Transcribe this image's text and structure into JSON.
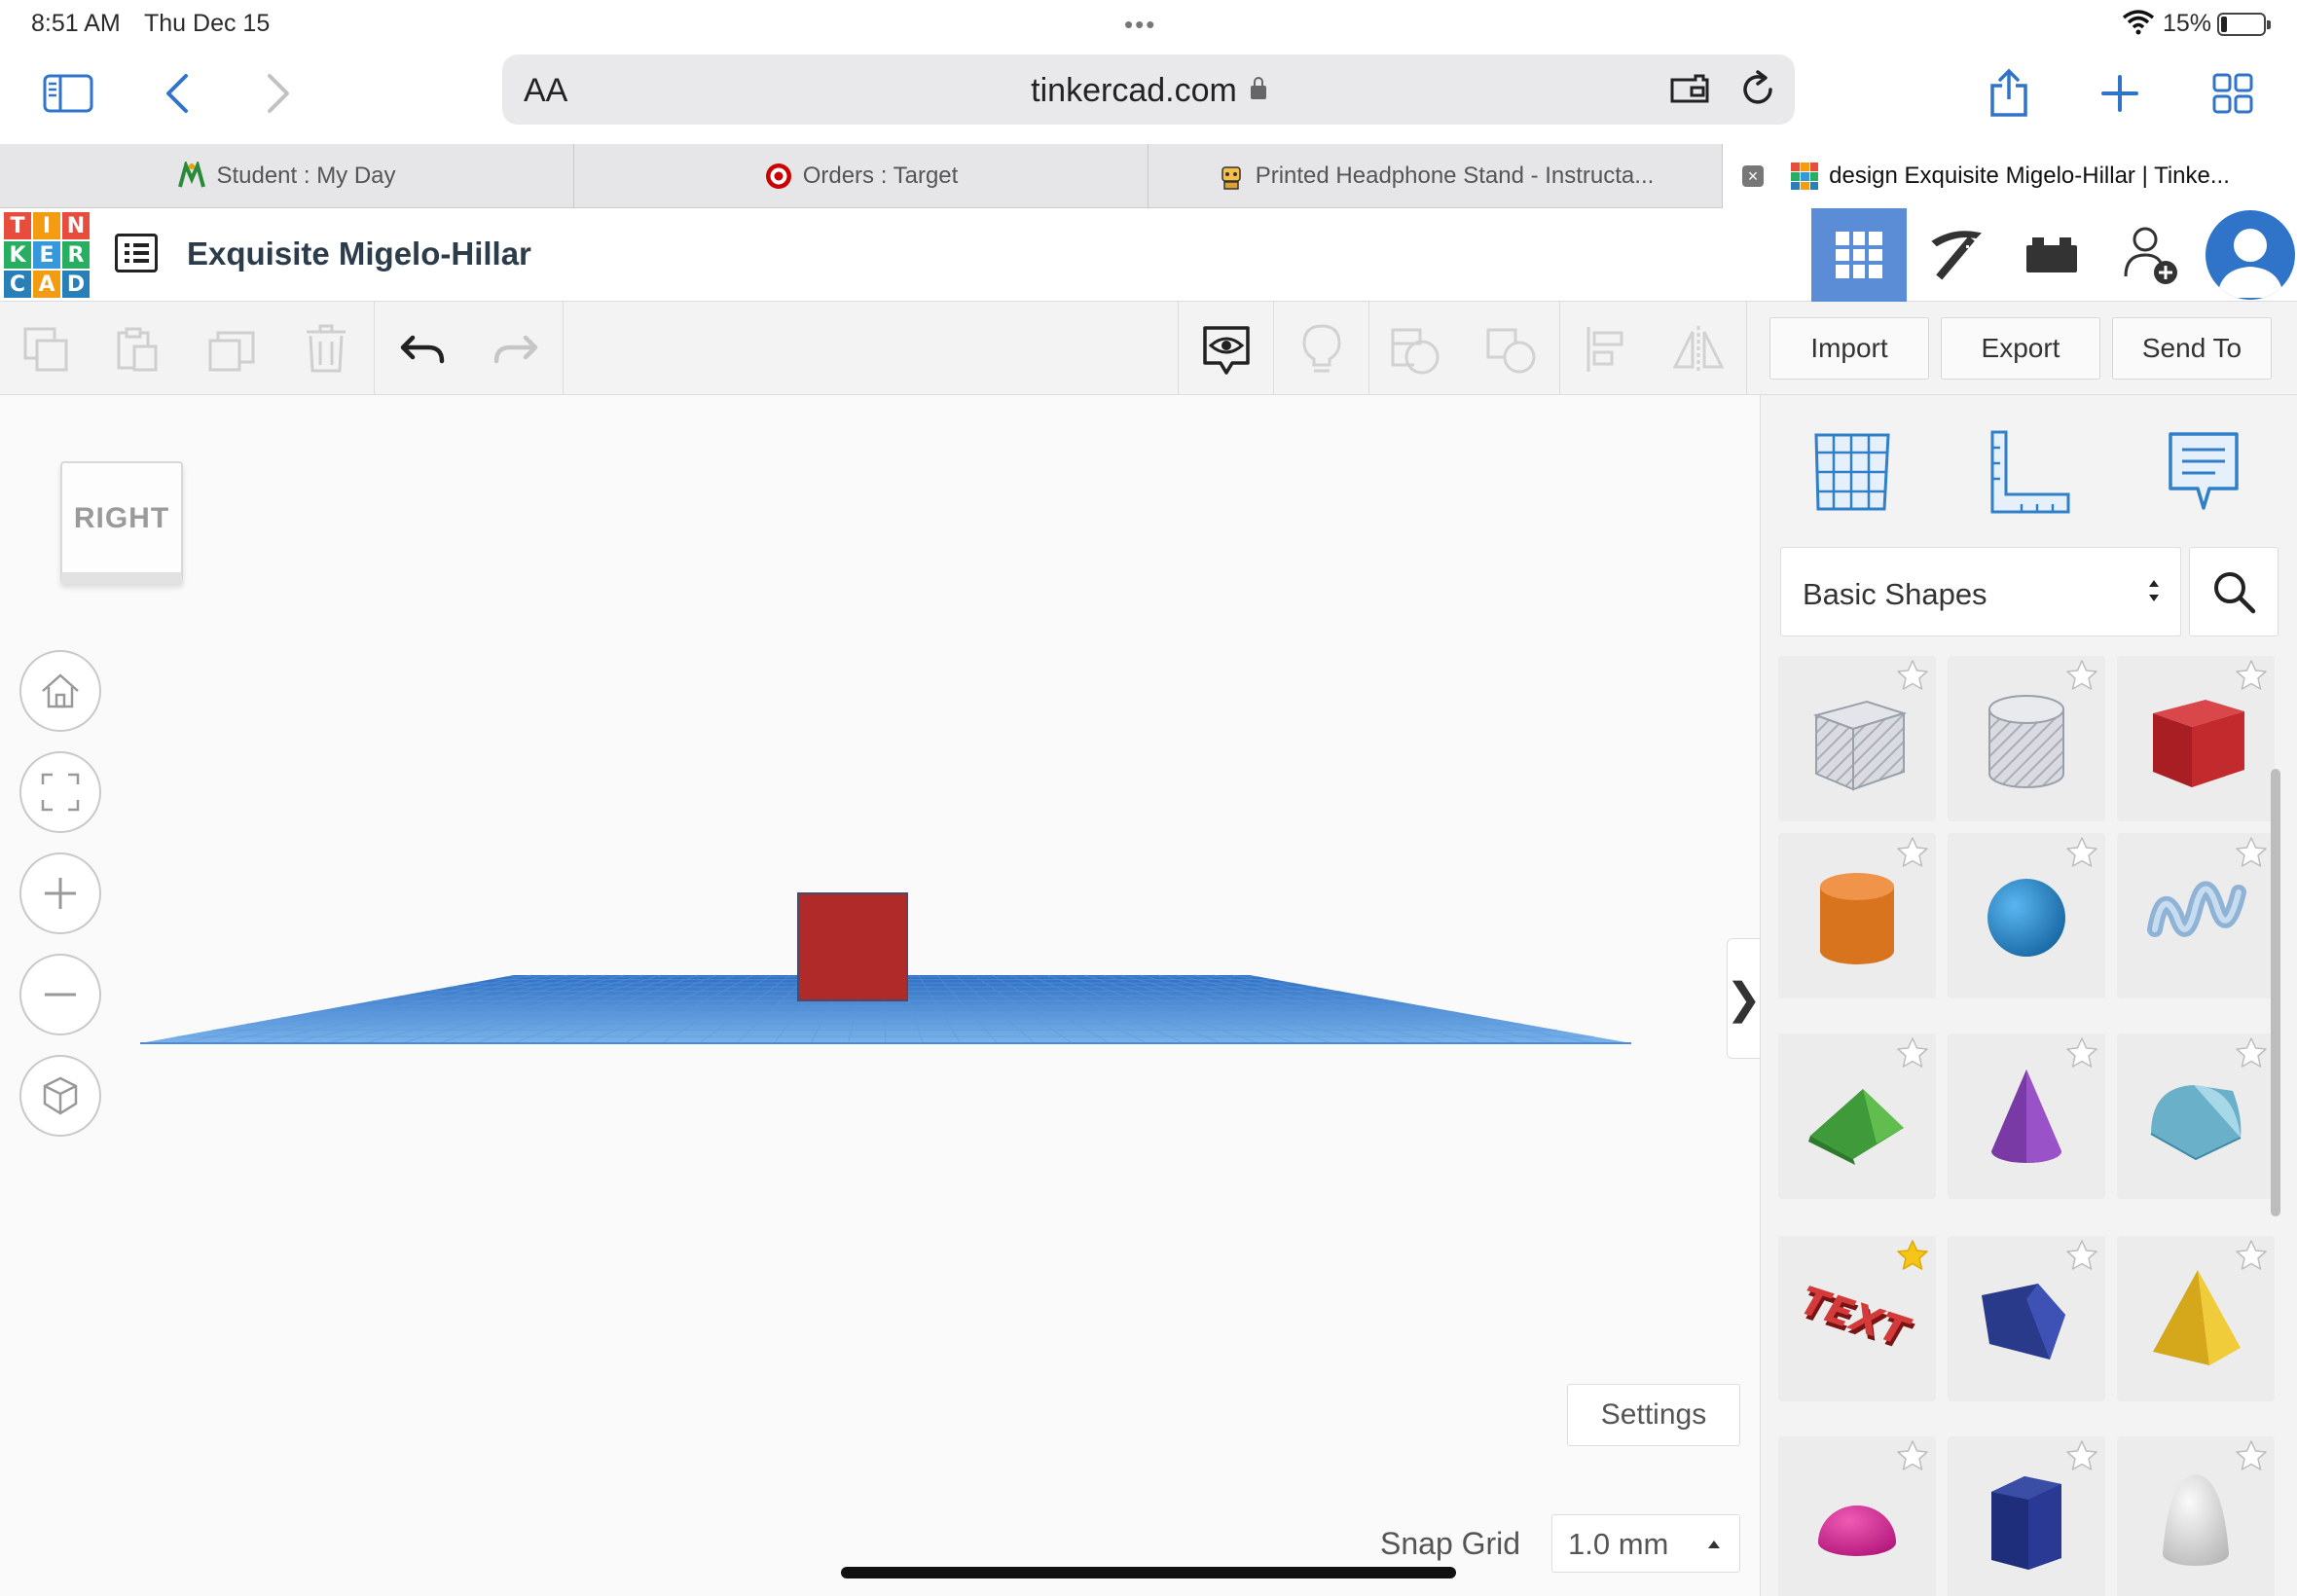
{
  "status_bar": {
    "time": "8:51 AM",
    "date": "Thu Dec 15",
    "dots": "•••",
    "battery_percent": "15%",
    "battery_level": 0.15
  },
  "safari": {
    "text_size_label": "AA",
    "url": "tinkercad.com"
  },
  "browser_tabs": [
    {
      "title": "Student : My Day",
      "favicon": "student-m-icon"
    },
    {
      "title": "Orders : Target",
      "favicon": "target-icon"
    },
    {
      "title": "Printed Headphone Stand - Instructa...",
      "favicon": "instructables-robot-icon"
    },
    {
      "title": "design Exquisite Migelo-Hillar | Tinke...",
      "favicon": "tinkercad-icon",
      "active": true
    }
  ],
  "logo": {
    "letters": [
      "T",
      "I",
      "N",
      "K",
      "E",
      "R",
      "C",
      "A",
      "D"
    ],
    "colors": [
      "#e74c3c",
      "#f39c12",
      "#e74c3c",
      "#27ae60",
      "#3498db",
      "#27ae60",
      "#2980b9",
      "#f39c12",
      "#2980b9"
    ]
  },
  "design": {
    "title": "Exquisite Migelo-Hillar"
  },
  "toolbar": {
    "import_label": "Import",
    "export_label": "Export",
    "send_to_label": "Send To"
  },
  "workplane": {
    "viewcube_label": "RIGHT",
    "settings_label": "Settings",
    "snap_grid_label": "Snap Grid",
    "snap_grid_value": "1.0 mm",
    "collapse_arrow": "❯"
  },
  "shapes_panel": {
    "category": "Basic Shapes"
  },
  "shapes": [
    {
      "name": "box-hole",
      "fav": false
    },
    {
      "name": "cylinder-hole",
      "fav": false
    },
    {
      "name": "box",
      "fav": false
    },
    {
      "name": "cylinder",
      "fav": false
    },
    {
      "name": "sphere",
      "fav": false
    },
    {
      "name": "scribble",
      "fav": false
    },
    {
      "name": "roof",
      "fav": false
    },
    {
      "name": "cone",
      "fav": false
    },
    {
      "name": "round-roof",
      "fav": false
    },
    {
      "name": "text",
      "fav": true
    },
    {
      "name": "wedge",
      "fav": false
    },
    {
      "name": "pyramid",
      "fav": false
    },
    {
      "name": "half-sphere",
      "fav": false
    },
    {
      "name": "polygon",
      "fav": false
    },
    {
      "name": "paraboloid",
      "fav": false
    }
  ],
  "colors": {
    "accent_blue": "#2f74c9",
    "grid_active": "#5b8dd6",
    "box_red": "#b12a2a",
    "plane_blue": "#3d86d6"
  }
}
